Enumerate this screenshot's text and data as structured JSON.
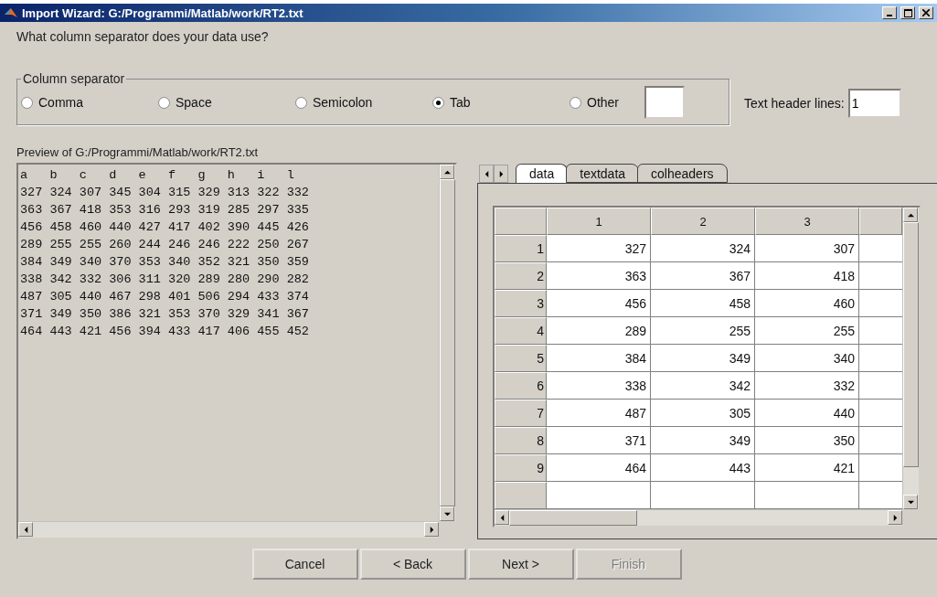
{
  "window": {
    "title": "Import Wizard: G:/Programmi/Matlab/work/RT2.txt"
  },
  "question": "What column separator does your data use?",
  "separator_group": {
    "legend": "Column separator",
    "options": [
      {
        "label": "Comma",
        "selected": false
      },
      {
        "label": "Space",
        "selected": false
      },
      {
        "label": "Semicolon",
        "selected": false
      },
      {
        "label": "Tab",
        "selected": true
      },
      {
        "label": "Other",
        "selected": false
      }
    ]
  },
  "header_lines": {
    "label": "Text header lines:",
    "value": "1"
  },
  "preview": {
    "label": "Preview of G:/Programmi/Matlab/work/RT2.txt",
    "lines": [
      "a   b   c   d   e   f   g   h   i   l",
      "327 324 307 345 304 315 329 313 322 332",
      "363 367 418 353 316 293 319 285 297 335",
      "456 458 460 440 427 417 402 390 445 426",
      "289 255 255 260 244 246 246 222 250 267",
      "384 349 340 370 353 340 352 321 350 359",
      "338 342 332 306 311 320 289 280 290 282",
      "487 305 440 467 298 401 506 294 433 374",
      "371 349 350 386 321 353 370 329 341 367",
      "464 443 421 456 394 433 417 406 455 452"
    ]
  },
  "tabs": [
    {
      "label": "data",
      "selected": true
    },
    {
      "label": "textdata",
      "selected": false
    },
    {
      "label": "colheaders",
      "selected": false
    }
  ],
  "table": {
    "columns": [
      "1",
      "2",
      "3"
    ],
    "rows": [
      {
        "header": "1",
        "cells": [
          "327",
          "324",
          "307"
        ]
      },
      {
        "header": "2",
        "cells": [
          "363",
          "367",
          "418"
        ]
      },
      {
        "header": "3",
        "cells": [
          "456",
          "458",
          "460"
        ]
      },
      {
        "header": "4",
        "cells": [
          "289",
          "255",
          "255"
        ]
      },
      {
        "header": "5",
        "cells": [
          "384",
          "349",
          "340"
        ]
      },
      {
        "header": "6",
        "cells": [
          "338",
          "342",
          "332"
        ]
      },
      {
        "header": "7",
        "cells": [
          "487",
          "305",
          "440"
        ]
      },
      {
        "header": "8",
        "cells": [
          "371",
          "349",
          "350"
        ]
      },
      {
        "header": "9",
        "cells": [
          "464",
          "443",
          "421"
        ]
      }
    ]
  },
  "buttons": [
    {
      "label": "Cancel",
      "disabled": false
    },
    {
      "label": "< Back",
      "disabled": false
    },
    {
      "label": "Next >",
      "disabled": false
    },
    {
      "label": "Finish",
      "disabled": true
    }
  ]
}
